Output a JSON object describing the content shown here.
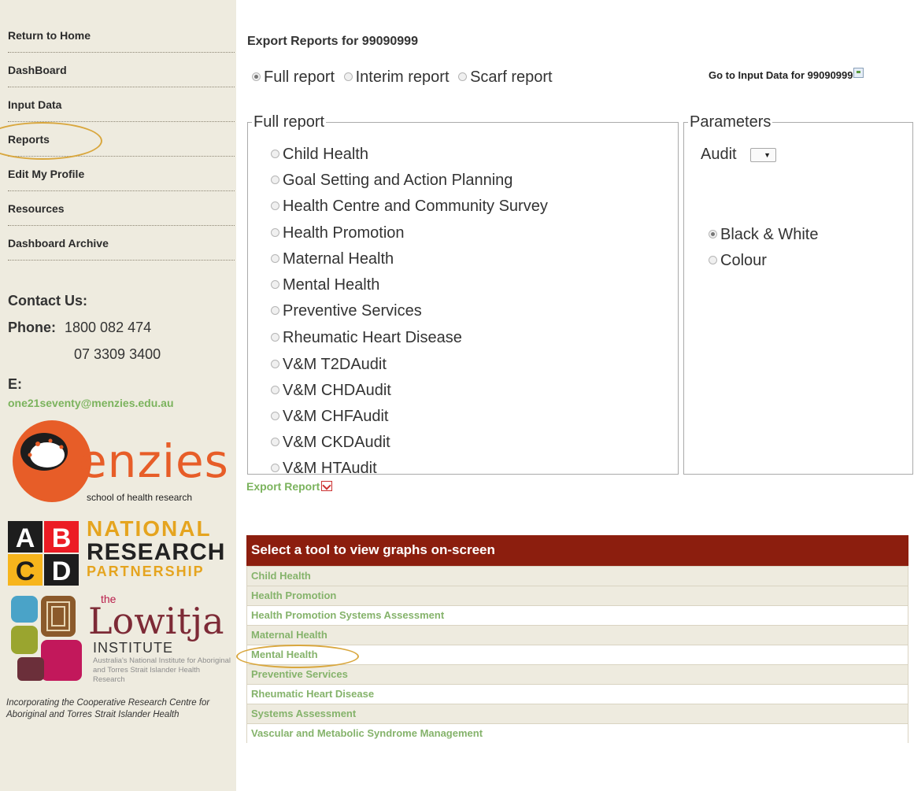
{
  "sidebar": {
    "nav": [
      "Return to Home",
      "DashBoard",
      "Input Data",
      "Reports",
      "Edit My Profile",
      "Resources",
      "Dashboard Archive"
    ],
    "contact_heading": "Contact Us:",
    "phone_label": "Phone:",
    "phone1": "1800 082 474",
    "phone2": "07 3309 3400",
    "email_label": "E:",
    "email": "one21seventy@menzies.edu.au",
    "logos": {
      "menzies_word": "enzies",
      "menzies_sub": "school of health research",
      "abcd": [
        "A",
        "B",
        "C",
        "D"
      ],
      "nrp": [
        "NATIONAL",
        "RESEARCH",
        "PARTNERSHIP"
      ],
      "lowitja_the": "the",
      "lowitja_name": "Lowitja",
      "lowitja_institute": "INSTITUTE",
      "lowitja_desc": "Australia's National Institute for Aboriginal and Torres Strait Islander Health Research"
    },
    "incorporating": "Incorporating the Cooperative Research Centre for Aboriginal and Torres Strait Islander Health"
  },
  "main": {
    "title": "Export Reports for 99090999",
    "report_types": [
      {
        "label": "Full report",
        "checked": true
      },
      {
        "label": "Interim report",
        "checked": false
      },
      {
        "label": "Scarf report",
        "checked": false
      }
    ],
    "goto_link": "Go to Input Data for 99090999",
    "full_report_legend": "Full report",
    "full_report_options": [
      "Child Health",
      "Goal Setting and Action Planning",
      "Health Centre and Community Survey",
      "Health Promotion",
      "Maternal Health",
      "Mental Health",
      "Preventive Services",
      "Rheumatic Heart Disease",
      "V&M T2DAudit",
      "V&M CHDAudit",
      "V&M CHFAudit",
      "V&M CKDAudit",
      "V&M HTAudit"
    ],
    "parameters_legend": "Parameters",
    "audit_label": "Audit",
    "audit_select_value": "",
    "color_options": [
      {
        "label": "Black & White",
        "checked": true
      },
      {
        "label": "Colour",
        "checked": false
      }
    ],
    "export_link": "Export Report",
    "tools_header": "Select a tool to view graphs on-screen",
    "tools": [
      "Child Health",
      "Health Promotion",
      "Health Promotion Systems Assessment",
      "Maternal Health",
      "Mental Health",
      "Preventive Services",
      "Rheumatic Heart Disease",
      "Systems Assessment",
      "Vascular and Metabolic Syndrome Management"
    ]
  },
  "colors": {
    "sidebar_bg": "#eeebdf",
    "header_red": "#8c1e0e",
    "link_green": "#7bb35d",
    "highlight_ring": "#d9a73e"
  }
}
